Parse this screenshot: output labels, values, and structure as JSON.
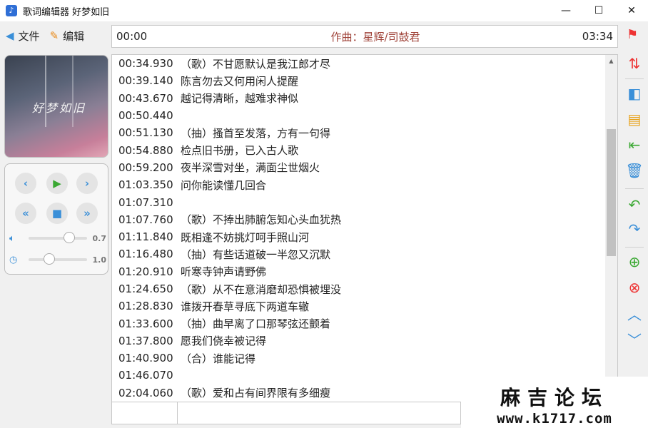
{
  "window": {
    "title": "歌词编辑器 好梦如旧",
    "minimize": "—",
    "maximize": "☐",
    "close": "✕"
  },
  "menu": {
    "file_label": "文件",
    "edit_label": "编辑"
  },
  "timebar": {
    "start": "00:00",
    "author": "作曲：星辉/司鼓君",
    "end": "03:34"
  },
  "cover": {
    "text": "好梦如旧"
  },
  "player": {
    "volume": "0.7",
    "speed": "1.0",
    "volume_level": 0.7,
    "speed_level": 0.35
  },
  "lyrics": [
    {
      "t": "00:34.930",
      "text": "（歌）不甘愿默认是我江郎才尽"
    },
    {
      "t": "00:39.140",
      "text": "陈言勿去又何用闲人提醒"
    },
    {
      "t": "00:43.670",
      "text": "越记得清晰，越难求神似"
    },
    {
      "t": "00:50.440",
      "text": ""
    },
    {
      "t": "00:51.130",
      "text": "（抽）搔首至发落，方有一句得"
    },
    {
      "t": "00:54.880",
      "text": "检点旧书册，已入古人歌"
    },
    {
      "t": "00:59.200",
      "text": "夜半深雪对坐，满面尘世烟火"
    },
    {
      "t": "01:03.350",
      "text": "问你能读懂几回合"
    },
    {
      "t": "01:07.310",
      "text": ""
    },
    {
      "t": "01:07.760",
      "text": "（歌）不捧出肺腑怎知心头血犹热"
    },
    {
      "t": "01:11.840",
      "text": "既相逢不妨挑灯呵手照山河"
    },
    {
      "t": "01:16.480",
      "text": "（抽）有些话道破一半忽又沉默"
    },
    {
      "t": "01:20.910",
      "text": "听寒寺钟声请野佛"
    },
    {
      "t": "01:24.650",
      "text": "（歌）从不在意消磨却恐惧被埋没"
    },
    {
      "t": "01:28.830",
      "text": "谁拨开春草寻底下两道车辙"
    },
    {
      "t": "01:33.600",
      "text": "（抽）曲早离了口那琴弦还颤着"
    },
    {
      "t": "01:37.800",
      "text": "愿我们侥幸被记得"
    },
    {
      "t": "01:40.900",
      "text": "（合）谁能记得"
    },
    {
      "t": "01:46.070",
      "text": ""
    },
    {
      "t": "02:04.060",
      "text": "（歌）爱和占有间界限有多细瘦"
    }
  ],
  "watermark": {
    "line1": "麻吉论坛",
    "line2": "www.k1717.com"
  },
  "colors": {
    "accent_blue": "#3a8fd8",
    "play_green": "#3aa832",
    "author_red": "#a0443a"
  }
}
